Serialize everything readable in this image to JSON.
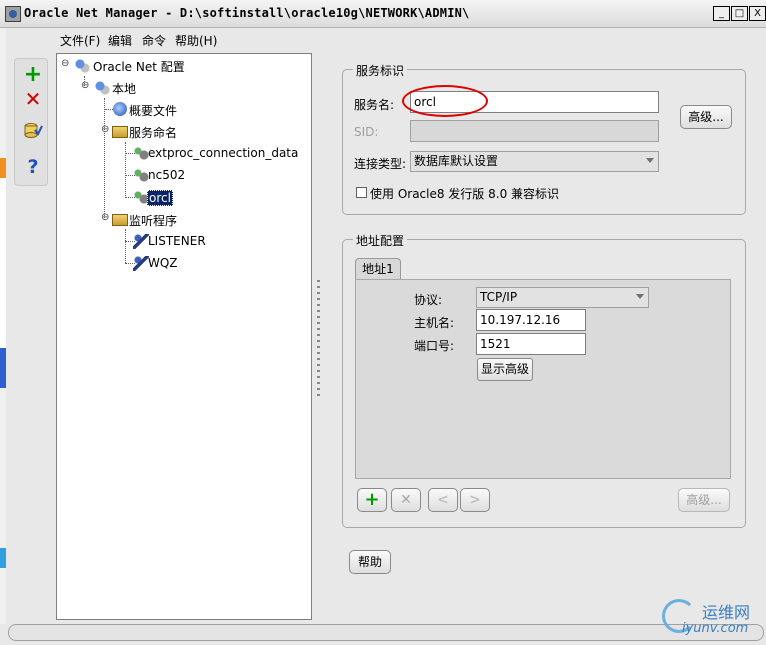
{
  "window": {
    "title": "Oracle Net Manager - D:\\softinstall\\oracle10g\\NETWORK\\ADMIN\\",
    "min_label": "_",
    "max_label": "□",
    "close_label": "X"
  },
  "menu": [
    "文件(F)",
    "编辑",
    "命令",
    "帮助(H)"
  ],
  "toolbar": {
    "add_label": "+",
    "delete_label": "✕",
    "help_label": "?"
  },
  "tree": {
    "root": "Oracle Net 配置",
    "local": "本地",
    "profile": "概要文件",
    "service_naming": "服务命名",
    "services": [
      "extproc_connection_data",
      "nc502",
      "orcl"
    ],
    "listeners_folder": "监听程序",
    "listeners": [
      "LISTENER",
      "WQZ"
    ]
  },
  "service_id": {
    "group_title": "服务标识",
    "service_name_label": "服务名:",
    "service_name_value": "orcl",
    "sid_label": "SID:",
    "sid_value": "",
    "advanced_label": "高级...",
    "connection_type_label": "连接类型:",
    "connection_type_value": "数据库默认设置",
    "oracle8_checkbox_label": "使用 Oracle8 发行版 8.0 兼容标识"
  },
  "address": {
    "group_title": "地址配置",
    "tab_label": "地址1",
    "protocol_label": "协议:",
    "protocol_value": "TCP/IP",
    "host_label": "主机名:",
    "host_value": "10.197.12.16",
    "port_label": "端口号:",
    "port_value": "1521",
    "show_advanced_label": "显示高级",
    "add_label": "+",
    "remove_label": "✕",
    "prev_label": "<",
    "next_label": ">",
    "advanced_label": "高级..."
  },
  "help_button": "帮助",
  "watermark": {
    "line1": "运维网",
    "line2": "iyunv.com"
  }
}
